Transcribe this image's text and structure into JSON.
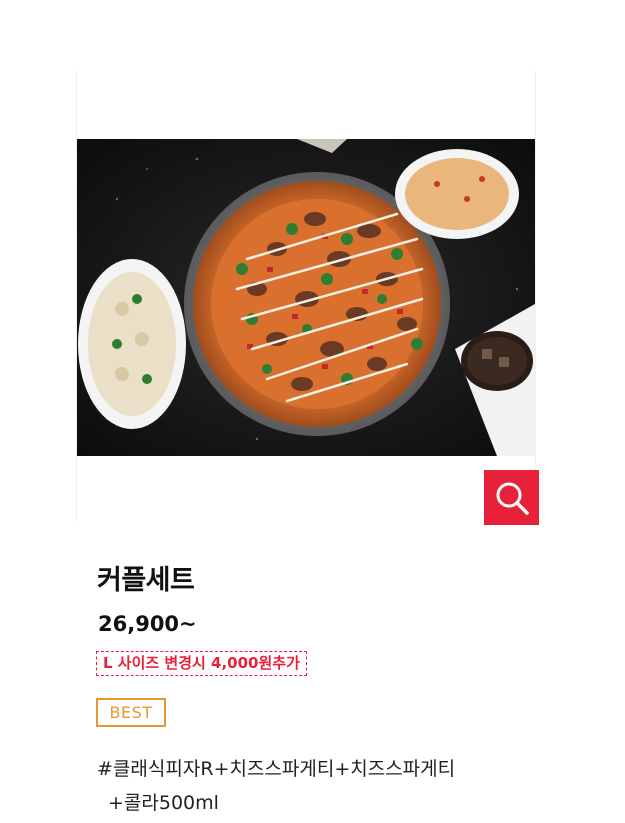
{
  "product": {
    "name": "커플세트",
    "price": "26,900~",
    "size_notice": "L 사이즈 변경시 4,000원추가",
    "badge": "BEST",
    "description_line1": "#클래식피자R+치즈스파게티+치즈스파게티",
    "description_line2": "+콜라500ml"
  },
  "icons": {
    "zoom": "magnifier-icon"
  },
  "colors": {
    "accent_red": "#e8213a",
    "badge_orange": "#e8962e",
    "text_dark": "#111111"
  }
}
